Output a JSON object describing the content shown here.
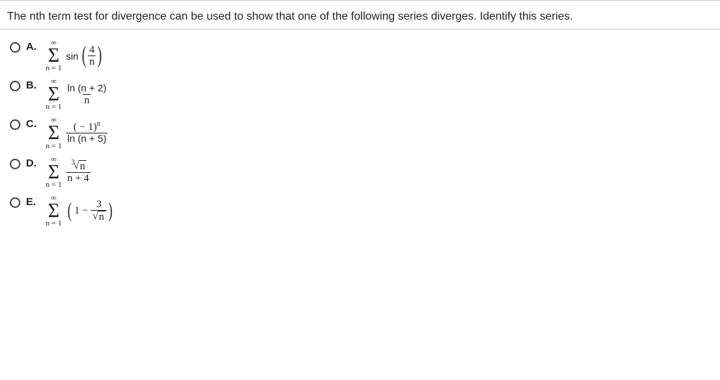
{
  "prompt": "The nth term test for divergence can be used to show that one of the following series diverges. Identify this series.",
  "sigma": {
    "top": "∞",
    "bot": "n = 1",
    "sym": "Σ"
  },
  "choices": {
    "A": {
      "letter": "A.",
      "sin_label": "sin",
      "frac_num": "4",
      "frac_den": "n"
    },
    "B": {
      "letter": "B.",
      "num_label": "ln (n + 2)",
      "den": "n"
    },
    "C": {
      "letter": "C.",
      "num": "( − 1)",
      "num_sup": "n",
      "den_label": "ln (n + 5)"
    },
    "D": {
      "letter": "D.",
      "root_index": "3",
      "root_body": "n",
      "den": "n + 4"
    },
    "E": {
      "letter": "E.",
      "one": "1 −",
      "frac_num": "3",
      "root_body": "n"
    }
  }
}
